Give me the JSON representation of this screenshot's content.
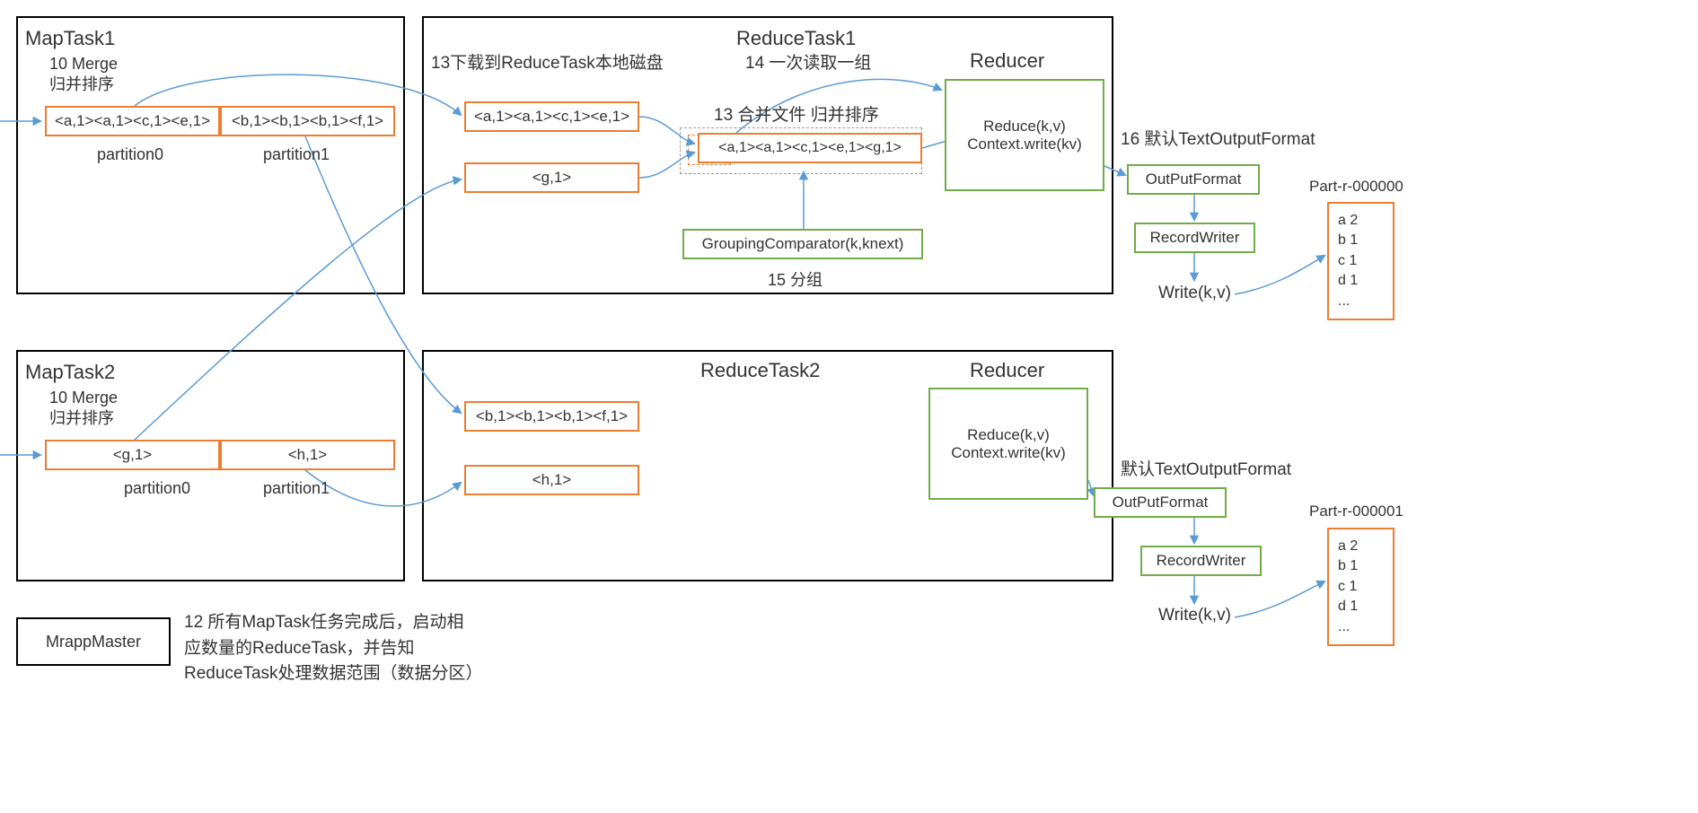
{
  "mapTask1": {
    "title": "MapTask1",
    "mergeLabel": "10 Merge\n归并排序",
    "partition0": {
      "data": "<a,1><a,1><c,1><e,1>",
      "label": "partition0"
    },
    "partition1": {
      "data": "<b,1><b,1><b,1><f,1>",
      "label": "partition1"
    }
  },
  "mapTask2": {
    "title": "MapTask2",
    "mergeLabel": "10 Merge\n归并排序",
    "partition0": {
      "data": "<g,1>",
      "label": "partition0"
    },
    "partition1": {
      "data": "<h,1>",
      "label": "partition1"
    }
  },
  "reduceTask1": {
    "title": "ReduceTask1",
    "downloadLabel": "13下载到ReduceTask本地磁盘",
    "buffer1": "<a,1><a,1><c,1><e,1>",
    "buffer2": "<g,1>",
    "mergeLabel": "13 合并文件 归并排序",
    "merged": "<a,1><a,1><c,1><e,1><g,1>",
    "readGroupLabel": "14 一次读取一组",
    "reducerLabel": "Reducer",
    "reducerBody": "Reduce(k,v)\nContext.write(kv)",
    "groupingLabel": "GroupingComparator(k,knext)",
    "groupStepLabel": "15 分组",
    "outputFormatLabel": "16 默认TextOutputFormat",
    "outputFormat": "OutPutFormat",
    "recordWriter": "RecordWriter",
    "writeLabel": "Write(k,v)",
    "outputFile": {
      "name": "Part-r-000000",
      "content": "a 2\nb 1\nc 1\nd 1\n..."
    }
  },
  "reduceTask2": {
    "title": "ReduceTask2",
    "buffer1": "<b,1><b,1><b,1><f,1>",
    "buffer2": "<h,1>",
    "reducerLabel": "Reducer",
    "reducerBody": "Reduce(k,v)\nContext.write(kv)",
    "outputFormatLabel": "默认TextOutputFormat",
    "outputFormat": "OutPutFormat",
    "recordWriter": "RecordWriter",
    "writeLabel": "Write(k,v)",
    "outputFile": {
      "name": "Part-r-000001",
      "content": "a 2\nb 1\nc 1\nd 1\n..."
    }
  },
  "mrappMaster": {
    "title": "MrappMaster",
    "description": "12 所有MapTask任务完成后，启动相\n应数量的ReduceTask，并告知\nReduceTask处理数据范围（数据分区）"
  }
}
